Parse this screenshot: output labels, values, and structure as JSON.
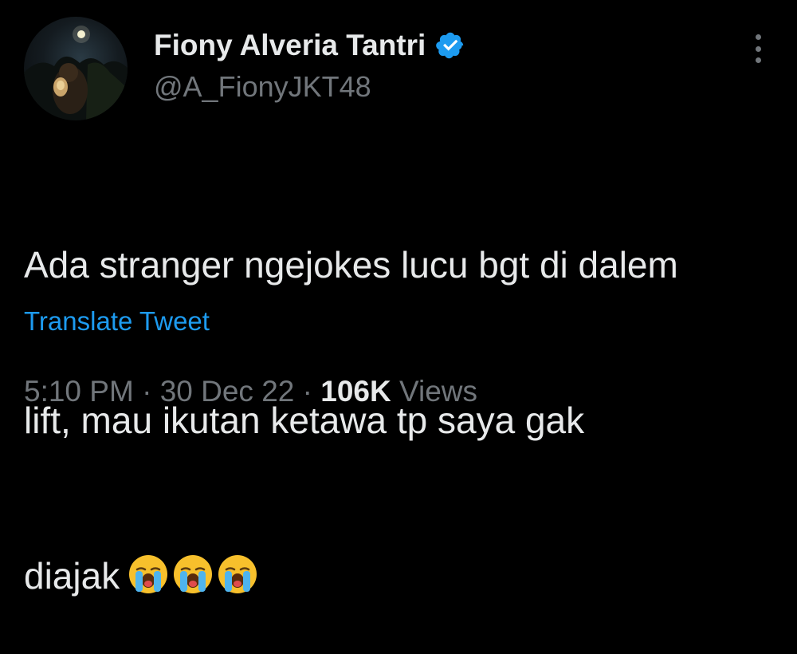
{
  "author": {
    "display_name": "Fiony Alveria Tantri",
    "handle": "@A_FionyJKT48",
    "verified_icon": "verified-badge-icon",
    "avatar_icon": "profile-photo"
  },
  "more_icon": "more-vertical-icon",
  "tweet": {
    "lines": [
      "Ada stranger ngejokes lucu bgt di dalem",
      "lift, mau ikutan ketawa tp saya gak",
      "diajak"
    ],
    "emoji": [
      "loudly-crying-face-emoji",
      "loudly-crying-face-emoji",
      "loudly-crying-face-emoji"
    ]
  },
  "translate_label": "Translate Tweet",
  "meta": {
    "time": "5:10 PM",
    "separator": "·",
    "date": "30 Dec 22",
    "views_count": "106K",
    "views_label": "Views"
  },
  "colors": {
    "background": "#000000",
    "text_primary": "#e7e9ea",
    "text_secondary": "#71767b",
    "link": "#1d9bf0",
    "verified": "#1d9bf0"
  }
}
